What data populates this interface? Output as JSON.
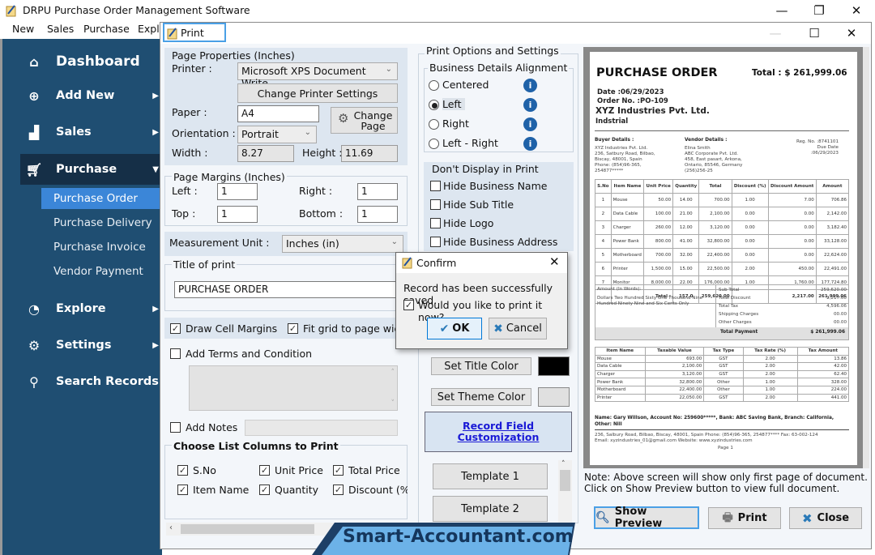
{
  "app": {
    "title": "DRPU Purchase Order Management Software",
    "menu": [
      "New",
      "Sales",
      "Purchase",
      "Explo"
    ]
  },
  "sidebar": {
    "items": [
      {
        "label": "Dashboard",
        "icon": "home-icon"
      },
      {
        "label": "Add New",
        "icon": "add-document-icon"
      },
      {
        "label": "Sales",
        "icon": "chart-icon"
      },
      {
        "label": "Purchase",
        "icon": "cart-icon"
      },
      {
        "label": "Explore",
        "icon": "pie-chart-icon"
      },
      {
        "label": "Settings",
        "icon": "gear-icon"
      },
      {
        "label": "Search Records",
        "icon": "search-icon"
      }
    ],
    "purchase_sub": [
      "Purchase Order",
      "Purchase Delivery",
      "Purchase Invoice",
      "Vendor Payment"
    ],
    "selected_sub": "Purchase Order"
  },
  "print_window": {
    "title": "Print",
    "page_properties": {
      "legend": "Page Properties (Inches)",
      "printer_label": "Printer :",
      "printer_value": "Microsoft XPS Document Write",
      "change_printer_btn": "Change Printer Settings",
      "paper_label": "Paper :",
      "paper_value": "A4",
      "change_page_btn_1": "Change",
      "change_page_btn_2": "Page",
      "orientation_label": "Orientation :",
      "orientation_value": "Portrait",
      "width_label": "Width :",
      "width_value": "8.27",
      "height_label": "Height :",
      "height_value": "11.69"
    },
    "margins": {
      "legend": "Page Margins (Inches)",
      "left_label": "Left :",
      "left_value": "1",
      "right_label": "Right :",
      "right_value": "1",
      "top_label": "Top  :",
      "top_value": "1",
      "bottom_label": "Bottom  :",
      "bottom_value": "1"
    },
    "measurement": {
      "label": "Measurement Unit :",
      "value": "Inches (in)"
    },
    "title_of_print": {
      "legend": "Title of print",
      "value": "PURCHASE ORDER"
    },
    "draw_cell_margins": {
      "label": "Draw Cell Margins",
      "checked": true
    },
    "fit_grid": {
      "label": "Fit grid to page width",
      "checked": true
    },
    "add_terms": {
      "label": "Add Terms and Condition",
      "checked": false
    },
    "add_notes": {
      "label": "Add Notes",
      "checked": false
    },
    "columns": {
      "legend": "Choose List Columns to Print",
      "items": [
        {
          "label": "S.No",
          "checked": true
        },
        {
          "label": "Unit Price",
          "checked": true
        },
        {
          "label": "Total Price",
          "checked": true
        },
        {
          "label": "Item Name",
          "checked": true
        },
        {
          "label": "Quantity",
          "checked": true
        },
        {
          "label": "Discount (%",
          "checked": true
        }
      ]
    },
    "print_options": {
      "legend": "Print Options and Settings",
      "alignment_legend": "Business Details Alignment",
      "alignment_options": [
        "Centered",
        "Left",
        "Right",
        "Left - Right"
      ],
      "alignment_selected": "Left",
      "dont_display_legend": "Don't Display in Print",
      "dont_display": [
        {
          "label": "Hide Business Name",
          "checked": false
        },
        {
          "label": "Hide Sub Title",
          "checked": false
        },
        {
          "label": "Hide Logo",
          "checked": false
        },
        {
          "label": "Hide Business Address",
          "checked": false
        }
      ],
      "set_title_color_btn": "Set Title Color",
      "title_color": "#000000",
      "set_theme_color_btn": "Set Theme Color",
      "theme_color": "#e0e0e0",
      "record_field_link_1": "Record Field",
      "record_field_link_2": "Customization",
      "templates": [
        "Template 1",
        "Template 2"
      ]
    },
    "note_1": "Note: Above screen will show only first page of document.",
    "note_2": "Click on Show Preview button to view full document.",
    "buttons": {
      "show_preview": "Show Preview",
      "print": "Print",
      "close": "Close"
    }
  },
  "confirm": {
    "title": "Confirm",
    "message": "Record has been successfully saved.",
    "checkbox_label": "Would you like to print it now?",
    "checkbox_checked": true,
    "ok": "OK",
    "cancel": "Cancel"
  },
  "document": {
    "title": "PURCHASE ORDER",
    "total": "Total : $  261,999.06",
    "date": "Date :06/29/2023",
    "order_no": "Order No. :PO-109",
    "company": "XYZ Industries Pvt. Ltd.",
    "subtitle": "Indstrial",
    "buyer_head": "Buyer Details :",
    "buyer_lines": [
      "XYZ Industries Pvt. Ltd.",
      "236, Satbury Road, Bilbao,",
      "Biscay, 48001, Spain",
      "Phone: (854)96-365,",
      "254877*****"
    ],
    "vendor_head": "Vendor Details :",
    "vendor_lines": [
      "Elina Smith",
      "ABC Corporate Pvt. Ltd.",
      "458, East pasart, Arkona,",
      "Ontario, 85546, Germany",
      "(256)256-25"
    ],
    "reg_no": "Reg. No. :8741101",
    "due_date": "Due Date :06/29/2023",
    "items_headers": [
      "S.No",
      "Item Name",
      "Unit Price",
      "Quantity",
      "Total",
      "Discount (%)",
      "Discount Amount",
      "Amount"
    ],
    "items": [
      [
        "1",
        "Mouse",
        "50.00",
        "14.00",
        "700.00",
        "1.00",
        "7.00",
        "706.86"
      ],
      [
        "2",
        "Data Cable",
        "100.00",
        "21.00",
        "2,100.00",
        "0.00",
        "0.00",
        "2,142.00"
      ],
      [
        "3",
        "Charger",
        "260.00",
        "12.00",
        "3,120.00",
        "0.00",
        "0.00",
        "3,182.40"
      ],
      [
        "4",
        "Power Bank",
        "800.00",
        "41.00",
        "32,800.00",
        "0.00",
        "0.00",
        "33,128.00"
      ],
      [
        "5",
        "Motherboard",
        "700.00",
        "32.00",
        "22,400.00",
        "0.00",
        "0.00",
        "22,624.00"
      ],
      [
        "6",
        "Printer",
        "1,500.00",
        "15.00",
        "22,500.00",
        "2.00",
        "450.00",
        "22,491.00"
      ],
      [
        "7",
        "Monitor",
        "8,000.00",
        "22.00",
        "176,000.00",
        "1.00",
        "1,760.00",
        "177,724.80"
      ]
    ],
    "items_total": [
      "",
      "",
      "Total :",
      "157.0",
      "259,620.00",
      "",
      "2,217.00",
      "261,999.06"
    ],
    "words_label": "Amount (In Words):",
    "words": "Dollars Two Hundred Sixty One Thousand Nine Hundred Ninety Nine and Six Cents Only",
    "summary": [
      [
        "Sub Total",
        "259,620.00"
      ],
      [
        "Total Discount",
        "2,217.00"
      ],
      [
        "Total Tax",
        "4,596.06"
      ],
      [
        "Shipping Charges",
        "00.00"
      ],
      [
        "Other Charges",
        "00.00"
      ]
    ],
    "total_payment_label": "Total Payment",
    "total_payment_value": "$  261,999.06",
    "tax_headers": [
      "Item Name",
      "Taxable Value",
      "Tax Type",
      "Tax Rate (%)",
      "Tax Amount"
    ],
    "tax_rows": [
      [
        "Mouse",
        "693.00",
        "GST",
        "2.00",
        "13.86"
      ],
      [
        "Data Cable",
        "2,100.00",
        "GST",
        "2.00",
        "42.00"
      ],
      [
        "Charger",
        "3,120.00",
        "GST",
        "2.00",
        "62.40"
      ],
      [
        "Power Bank",
        "32,800.00",
        "Other",
        "1.00",
        "328.00"
      ],
      [
        "Motherboard",
        "22,400.00",
        "Other",
        "1.00",
        "224.00"
      ],
      [
        "Printer",
        "22,050.00",
        "GST",
        "2.00",
        "441.00"
      ]
    ],
    "bank": "Name: Gary Willson, Account No: 259600*****, Bank: ABC Saving Bank, Branch: California, Other: Nill",
    "footer_1": "236, Salbury Road, Bilbao, Biscay, 48001, Spain  Phone: (854)96-365, 254877****  Fax: 63-002-124",
    "footer_2": "Email: xyzindustries_01@gmail.com   Website: www.xyzindustries.com",
    "page": "Page 1"
  },
  "watermark": "Smart-Accountant.com"
}
